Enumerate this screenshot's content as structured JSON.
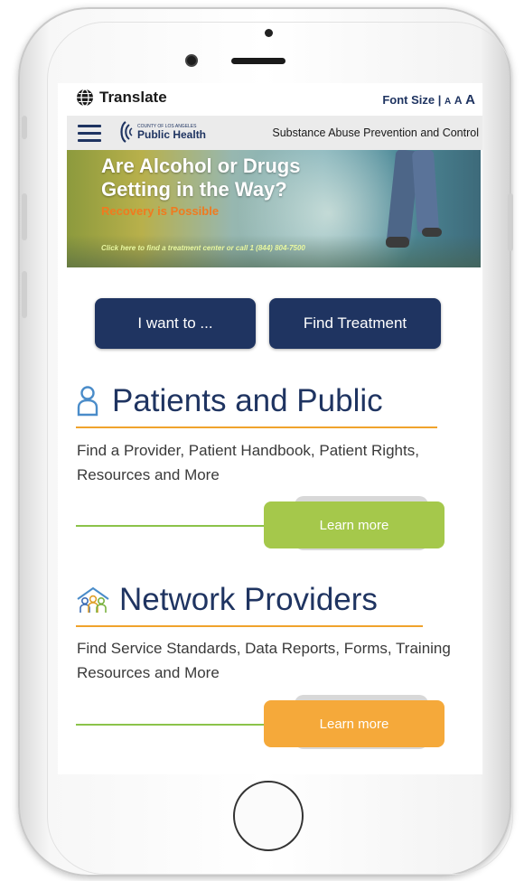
{
  "topbar": {
    "translate_label": "Translate",
    "font_size_label": "Font Size |",
    "font_a_small": "A",
    "font_a_medium": "A",
    "font_a_large": "A"
  },
  "navbar": {
    "logo_small": "COUNTY OF LOS ANGELES",
    "logo_big": "Public Health",
    "program": "Substance Abuse Prevention and Control"
  },
  "banner": {
    "headline_line1": "Are Alcohol or Drugs",
    "headline_line2": "Getting in the Way?",
    "subhead": "Recovery is Possible",
    "cta": "Click here to find a treatment center or call 1 (844) 804-7500"
  },
  "actions": {
    "i_want_to": "I want to ...",
    "find_treatment": "Find Treatment"
  },
  "sections": [
    {
      "title": "Patients and Public",
      "icon": "person-icon",
      "description": "Find a Provider, Patient Handbook, Patient Rights, Resources and More",
      "button": "Learn more",
      "button_color": "#a5c84b"
    },
    {
      "title": "Network Providers",
      "icon": "group-house-icon",
      "description": "Find Service Standards, Data Reports, Forms, Training Resources and More",
      "button": "Learn more",
      "button_color": "#f5a93a"
    }
  ],
  "colors": {
    "brand_navy": "#1f3461",
    "accent_orange": "#f0a32c",
    "accent_green": "#8bc34a"
  }
}
